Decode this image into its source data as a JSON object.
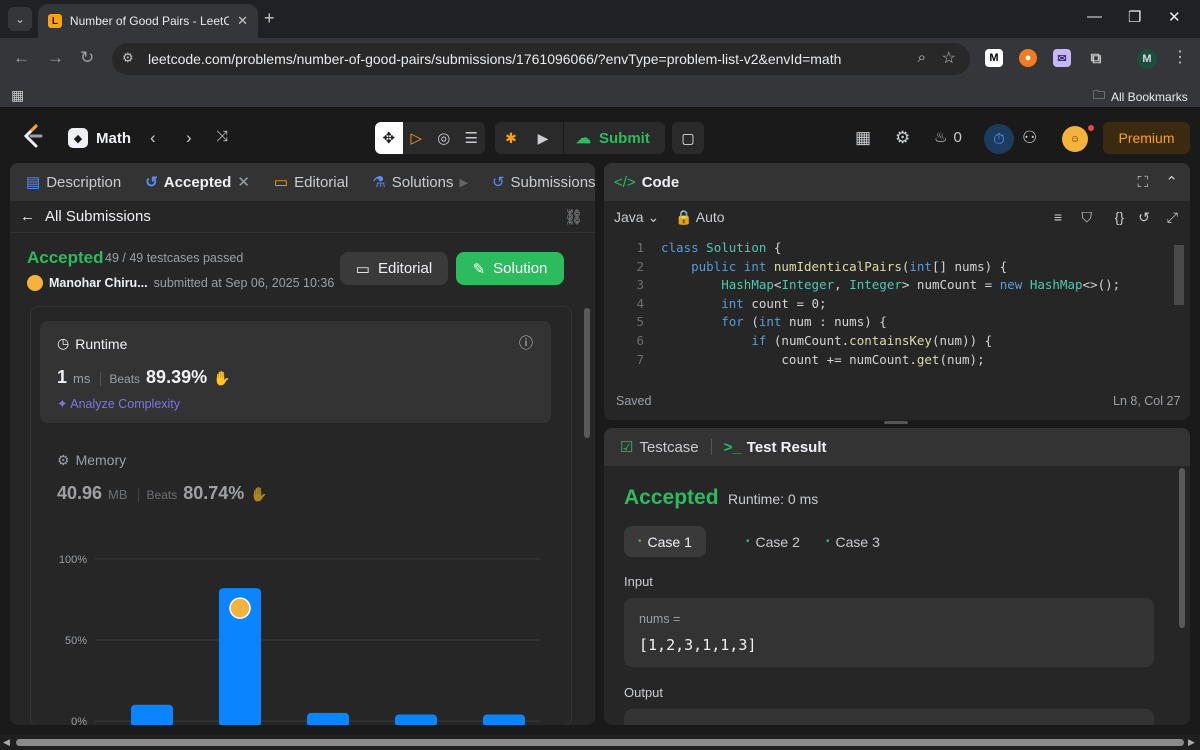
{
  "browser": {
    "tab_title": "Number of Good Pairs - LeetCo",
    "url": "leetcode.com/problems/number-of-good-pairs/submissions/1761096066/?envType=problem-list-v2&envId=math",
    "all_bookmarks": "All Bookmarks",
    "extensions": [
      "M",
      "M"
    ]
  },
  "nav": {
    "problem_list": "Math",
    "submit_label": "Submit",
    "streak_count": "0",
    "premium_label": "Premium"
  },
  "left_tabs": [
    "Description",
    "Accepted",
    "Editorial",
    "Solutions",
    "Submissions"
  ],
  "submission": {
    "back_label": "All Submissions",
    "status": "Accepted",
    "testcases": "49 / 49 testcases passed",
    "user": "Manohar Chiru...",
    "submitted_at": "submitted at Sep 06, 2025 10:36",
    "editorial_btn": "Editorial",
    "solution_btn": "Solution"
  },
  "runtime": {
    "label": "Runtime",
    "value": "1",
    "unit": "ms",
    "beats_label": "Beats",
    "beats": "89.39%",
    "analyze": "Analyze Complexity"
  },
  "memory": {
    "label": "Memory",
    "value": "40.96",
    "unit": "MB",
    "beats_label": "Beats",
    "beats": "80.74%"
  },
  "chart_data": {
    "type": "bar",
    "ytick_labels": [
      "100%",
      "50%",
      "0%"
    ],
    "ylim": [
      0,
      100
    ],
    "values": [
      10,
      82,
      5,
      4,
      4
    ],
    "highlight_index": 1,
    "bar_color": "#0a84ff",
    "grid": true
  },
  "code": {
    "title": "Code",
    "language": "Java",
    "mode": "Auto",
    "lines": [
      {
        "n": "1",
        "html": "<span class='kw'>class</span> <span class='ty'>Solution</span> {"
      },
      {
        "n": "2",
        "html": "    <span class='kw'>public</span> <span class='kw'>int</span> <span class='fn'>numIdenticalPairs</span>(<span class='kw'>int</span>[] nums) {"
      },
      {
        "n": "3",
        "html": "        <span class='ty'>HashMap</span>&lt;<span class='ty'>Integer</span>, <span class='ty'>Integer</span>&gt; numCount = <span class='kw'>new</span> <span class='ty'>HashMap</span>&lt;&gt;();"
      },
      {
        "n": "4",
        "html": "        <span class='kw'>int</span> count = 0;"
      },
      {
        "n": "5",
        "html": "        <span class='kw'>for</span> (<span class='kw'>int</span> num : nums) {"
      },
      {
        "n": "6",
        "html": "            <span class='kw'>if</span> (numCount.<span class='fn'>containsKey</span>(num)) {"
      },
      {
        "n": "7",
        "html": "                count += numCount.<span class='fn'>get</span>(num);"
      }
    ],
    "saved": "Saved",
    "position": "Ln 8, Col 27"
  },
  "result": {
    "tab_testcase": "Testcase",
    "tab_result": "Test Result",
    "status": "Accepted",
    "runtime": "Runtime: 0 ms",
    "cases": [
      "Case 1",
      "Case 2",
      "Case 3"
    ],
    "input_label": "Input",
    "var_name": "nums =",
    "var_value": "[1,2,3,1,1,3]",
    "output_label": "Output"
  }
}
